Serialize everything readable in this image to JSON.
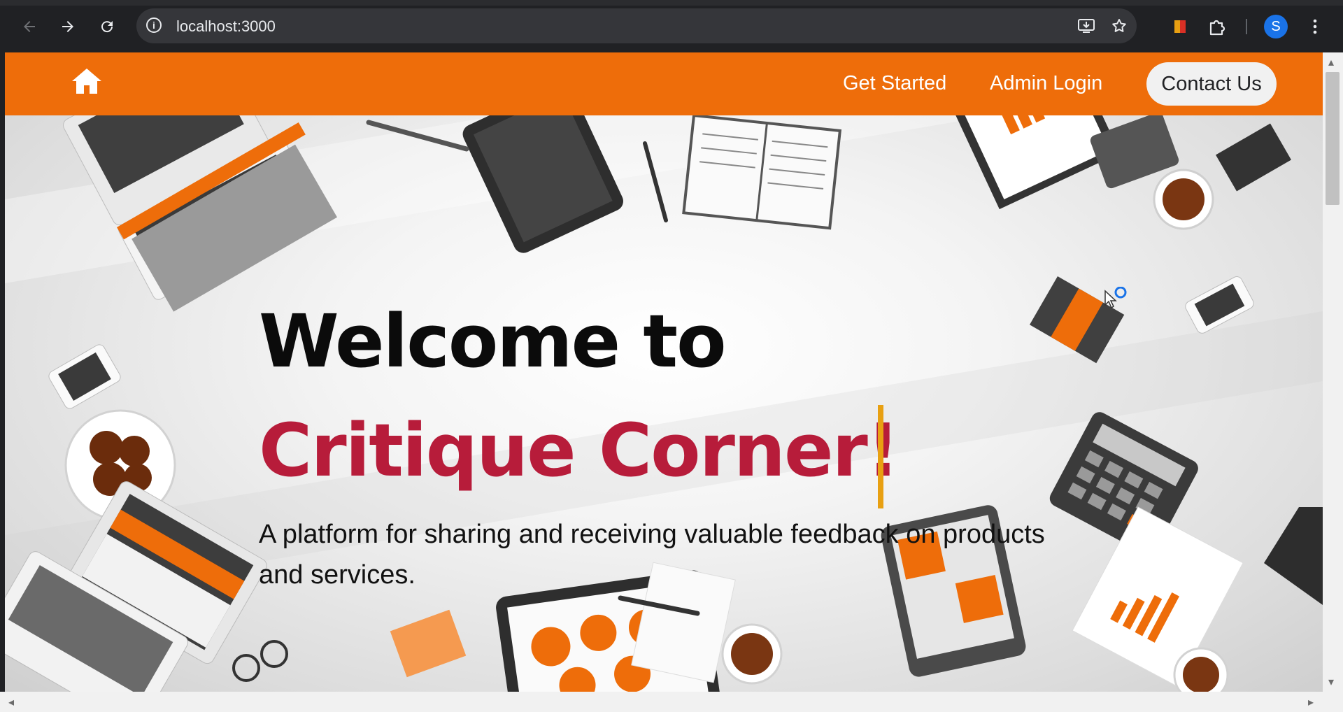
{
  "browser": {
    "url": "localhost:3000",
    "profile_initial": "S",
    "icons": {
      "back": "back-arrow-icon",
      "forward": "forward-arrow-icon",
      "reload": "reload-icon",
      "info": "site-info-icon",
      "install": "install-app-icon",
      "bookmark": "star-icon",
      "extension_pin": "extension-icon",
      "extensions": "puzzle-icon",
      "menu": "kebab-menu-icon"
    }
  },
  "navbar": {
    "home_icon": "home-icon",
    "links": [
      "Get Started",
      "Admin Login"
    ],
    "contact_label": "Contact Us",
    "color": "#ee6d0a"
  },
  "hero": {
    "line1": "Welcome to",
    "line2": "Critique Corner!",
    "subtitle": "A platform for sharing and receiving valuable feedback on products and services.",
    "accent_color": "#b71c3a",
    "caret_color": "#e8a012"
  }
}
